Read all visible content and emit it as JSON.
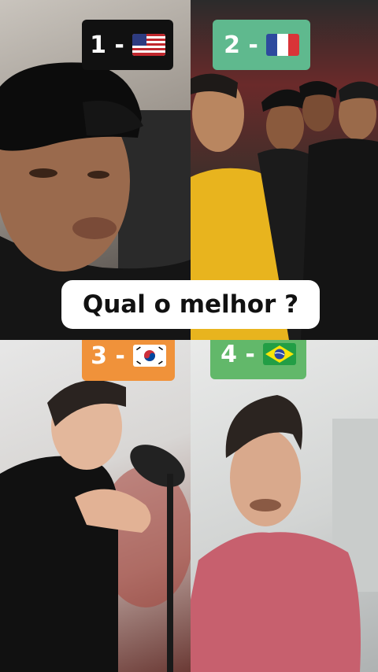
{
  "quadrants": [
    {
      "number_label": "1 -",
      "flag_icon": "usa-flag-icon",
      "badge_color": "#111111"
    },
    {
      "number_label": "2 -",
      "flag_icon": "france-flag-icon",
      "badge_color": "#5fb98e"
    },
    {
      "number_label": "3 -",
      "flag_icon": "south-korea-flag-icon",
      "badge_color": "#f0923a"
    },
    {
      "number_label": "4 -",
      "flag_icon": "brazil-flag-icon",
      "badge_color": "#62b86a"
    }
  ],
  "question": "Qual o melhor ?"
}
